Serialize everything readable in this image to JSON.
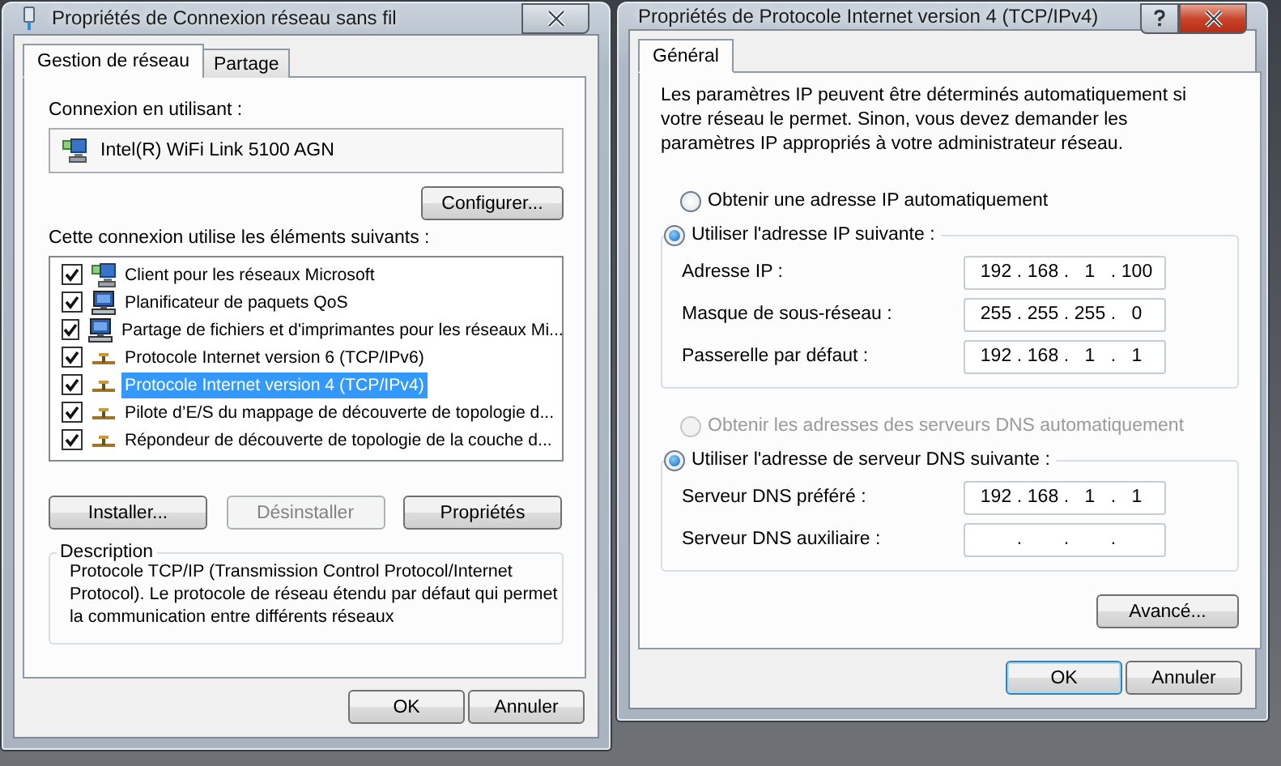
{
  "ip_separator": ".",
  "network_dialog": {
    "title": "Propriétés de Connexion réseau sans fil",
    "tabs": [
      {
        "label": "Gestion de réseau",
        "selected": true
      },
      {
        "label": "Partage",
        "selected": false
      }
    ],
    "connect_label": "Connexion en utilisant :",
    "adapter": "Intel(R) WiFi Link 5100 AGN",
    "configure_button": "Configurer...",
    "components_label": "Cette connexion utilise les éléments suivants :",
    "components": [
      {
        "kind": "client",
        "name": "Client pour les réseaux Microsoft",
        "checked": true,
        "selected": false
      },
      {
        "kind": "service",
        "name": "Planificateur de paquets QoS",
        "checked": true,
        "selected": false
      },
      {
        "kind": "service",
        "name": "Partage de fichiers et d'imprimantes pour les réseaux Mi...",
        "checked": true,
        "selected": false
      },
      {
        "kind": "protocol",
        "name": "Protocole Internet version 6 (TCP/IPv6)",
        "checked": true,
        "selected": false
      },
      {
        "kind": "protocol",
        "name": "Protocole Internet version 4 (TCP/IPv4)",
        "checked": true,
        "selected": true
      },
      {
        "kind": "protocol",
        "name": "Pilote d’E/S du mappage de découverte de topologie d...",
        "checked": true,
        "selected": false
      },
      {
        "kind": "protocol",
        "name": "Répondeur de découverte de topologie de la couche d...",
        "checked": true,
        "selected": false
      }
    ],
    "buttons": [
      {
        "label": "Installer...",
        "disabled": false
      },
      {
        "label": "Désinstaller",
        "disabled": true
      },
      {
        "label": "Propriétés",
        "disabled": false
      }
    ],
    "description": {
      "legend": "Description",
      "text": "Protocole TCP/IP (Transmission Control Protocol/Internet Protocol). Le protocole de réseau étendu par défaut qui permet la communication entre différents réseaux"
    },
    "footer_buttons": [
      {
        "label": "OK",
        "default": false
      },
      {
        "label": "Annuler",
        "default": false
      }
    ]
  },
  "ipv4_dialog": {
    "title": "Propriétés de Protocole Internet version 4 (TCP/IPv4)",
    "tabs": [
      {
        "label": "Général",
        "selected": true
      }
    ],
    "intro": "Les paramètres IP peuvent être déterminés automatiquement si votre réseau le permet. Sinon, vous devez demander les paramètres IP appropriés à votre administrateur réseau.",
    "sections": [
      {
        "auto_option": {
          "label": "Obtenir une adresse IP automatiquement",
          "selected": false,
          "disabled": false
        },
        "manual_option": {
          "label": "Utiliser l'adresse IP suivante :",
          "selected": true,
          "disabled": false
        },
        "fields": [
          {
            "label": "Adresse IP :",
            "octets": [
              "192",
              "168",
              "1",
              "100"
            ]
          },
          {
            "label": "Masque de sous-réseau :",
            "octets": [
              "255",
              "255",
              "255",
              "0"
            ]
          },
          {
            "label": "Passerelle par défaut :",
            "octets": [
              "192",
              "168",
              "1",
              "1"
            ]
          }
        ]
      },
      {
        "auto_option": {
          "label": "Obtenir les adresses des serveurs DNS automatiquement",
          "selected": false,
          "disabled": true
        },
        "manual_option": {
          "label": "Utiliser l'adresse de serveur DNS suivante :",
          "selected": true,
          "disabled": false
        },
        "fields": [
          {
            "label": "Serveur DNS préféré :",
            "octets": [
              "192",
              "168",
              "1",
              "1"
            ]
          },
          {
            "label": "Serveur DNS auxiliaire :"
          }
        ]
      }
    ],
    "advanced_button": "Avancé...",
    "footer_buttons": [
      {
        "label": "OK",
        "default": true
      },
      {
        "label": "Annuler",
        "default": false
      }
    ]
  }
}
